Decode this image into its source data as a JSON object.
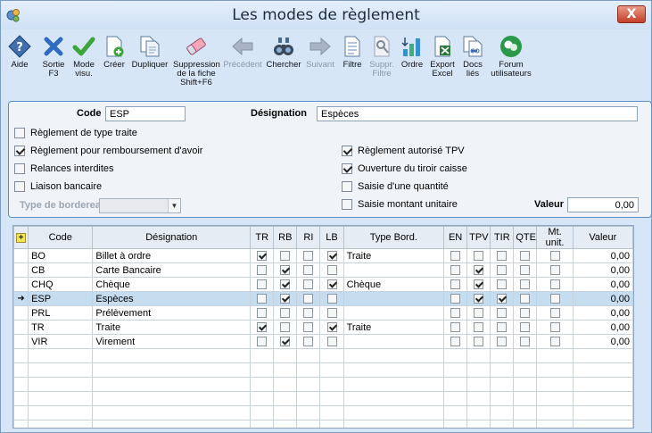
{
  "window": {
    "title": "Les modes de règlement",
    "close_label": "X"
  },
  "toolbar": {
    "aide": "Aide",
    "sortie": "Sortie F3",
    "mode": "Mode visu.",
    "creer": "Créer",
    "dupliquer": "Dupliquer",
    "suppression": "Suppression de la fiche Shift+F6",
    "precedent": "Précédent",
    "chercher": "Chercher",
    "suivant": "Suivant",
    "filtre": "Filtre",
    "suppr_filtre": "Suppr. Filtre",
    "ordre": "Ordre",
    "export": "Export Excel",
    "docs": "Docs liés",
    "forum": "Forum utilisateurs"
  },
  "form": {
    "code_label": "Code",
    "code_value": "ESP",
    "designation_label": "Désignation",
    "designation_value": "Espèces",
    "checks_left": [
      {
        "label": "Règlement de type traite",
        "checked": false
      },
      {
        "label": "Règlement pour remboursement d'avoir",
        "checked": true
      },
      {
        "label": "Relances interdites",
        "checked": false
      },
      {
        "label": "Liaison bancaire",
        "checked": false
      }
    ],
    "checks_right": [
      {
        "label": "Règlement autorisé TPV",
        "checked": true
      },
      {
        "label": "Ouverture du tiroir caisse",
        "checked": true
      },
      {
        "label": "Saisie d'une quantité",
        "checked": false
      },
      {
        "label": "Saisie montant unitaire",
        "checked": false
      }
    ],
    "type_bordereau_label": "Type de borderea",
    "valeur_label": "Valeur",
    "valeur_value": "0,00"
  },
  "grid": {
    "headers": [
      "Code",
      "Désignation",
      "TR",
      "RB",
      "RI",
      "LB",
      "Type Bord.",
      "EN",
      "TPV",
      "TIR",
      "QTE",
      "Mt. unit.",
      "Valeur"
    ],
    "rows": [
      {
        "code": "BO",
        "designation": "Billet à ordre",
        "tr": true,
        "rb": false,
        "ri": false,
        "lb": true,
        "type_bord": "Traite",
        "en": false,
        "tpv": false,
        "tir": false,
        "qte": false,
        "mt": false,
        "valeur": "0,00"
      },
      {
        "code": "CB",
        "designation": "Carte Bancaire",
        "tr": false,
        "rb": true,
        "ri": false,
        "lb": false,
        "type_bord": "",
        "en": false,
        "tpv": true,
        "tir": false,
        "qte": false,
        "mt": false,
        "valeur": "0,00"
      },
      {
        "code": "CHQ",
        "designation": "Chèque",
        "tr": false,
        "rb": true,
        "ri": false,
        "lb": true,
        "type_bord": "Chèque",
        "en": false,
        "tpv": true,
        "tir": false,
        "qte": false,
        "mt": false,
        "valeur": "0,00"
      },
      {
        "code": "ESP",
        "designation": "Espèces",
        "tr": false,
        "rb": true,
        "ri": false,
        "lb": false,
        "type_bord": "",
        "en": false,
        "tpv": true,
        "tir": true,
        "qte": false,
        "mt": false,
        "valeur": "0,00",
        "selected": true
      },
      {
        "code": "PRL",
        "designation": "Prélèvement",
        "tr": false,
        "rb": false,
        "ri": false,
        "lb": false,
        "type_bord": "",
        "en": false,
        "tpv": false,
        "tir": false,
        "qte": false,
        "mt": false,
        "valeur": "0,00"
      },
      {
        "code": "TR",
        "designation": "Traite",
        "tr": true,
        "rb": false,
        "ri": false,
        "lb": true,
        "type_bord": "Traite",
        "en": false,
        "tpv": false,
        "tir": false,
        "qte": false,
        "mt": false,
        "valeur": "0,00"
      },
      {
        "code": "VIR",
        "designation": "Virement",
        "tr": false,
        "rb": true,
        "ri": false,
        "lb": false,
        "type_bord": "",
        "en": false,
        "tpv": false,
        "tir": false,
        "qte": false,
        "mt": false,
        "valeur": "0,00"
      }
    ],
    "empty_rows": 6
  },
  "colors": {
    "accent": "#5b8fc7",
    "selected_row": "#c6dcef",
    "close_button": "#c4402a"
  },
  "icons": [
    "help-icon",
    "exit-icon",
    "check-icon",
    "create-icon",
    "duplicate-icon",
    "eraser-icon",
    "arrow-left-icon",
    "binoculars-icon",
    "arrow-right-icon",
    "filter-icon",
    "remove-filter-icon",
    "sort-icon",
    "excel-icon",
    "linked-docs-icon",
    "forum-icon"
  ]
}
